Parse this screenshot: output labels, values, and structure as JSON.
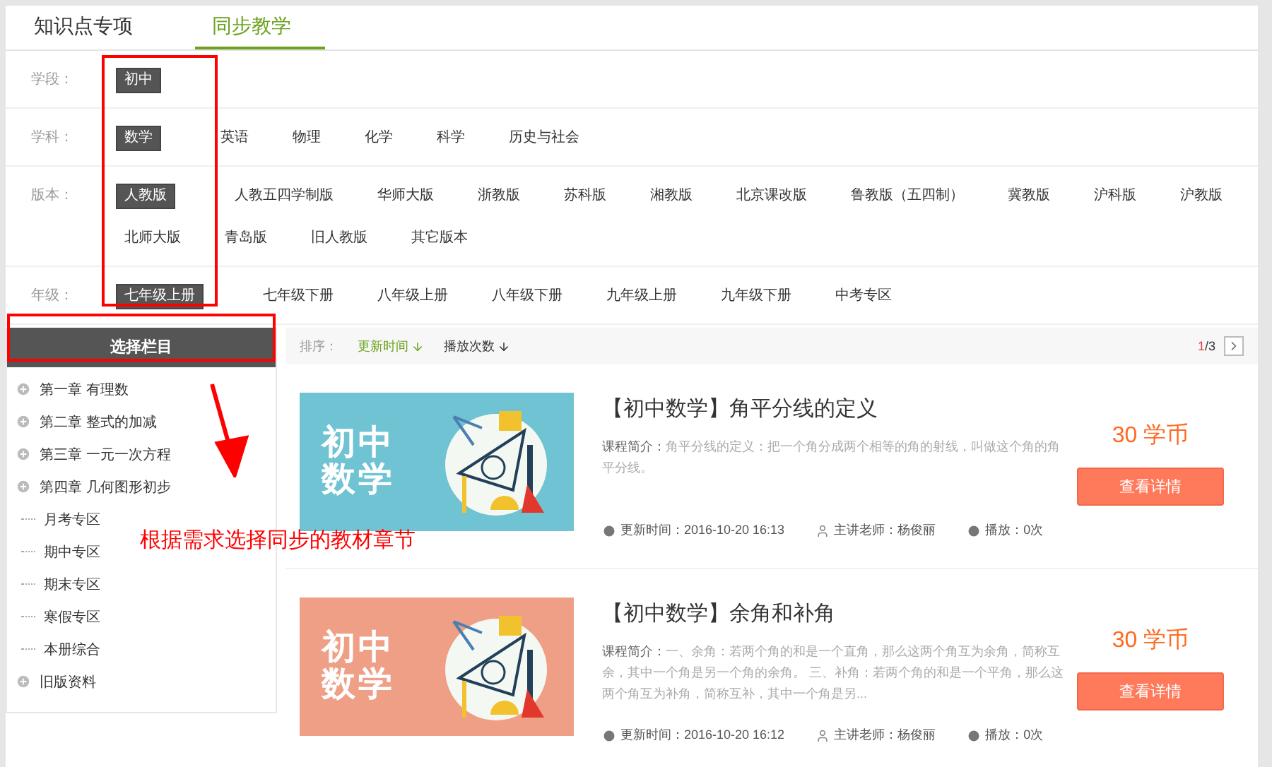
{
  "tabs": [
    {
      "label": "知识点专项",
      "selected": false
    },
    {
      "label": "同步教学",
      "selected": true
    }
  ],
  "filters": [
    {
      "label": "学段：",
      "options": [
        {
          "text": "初中",
          "selected": true
        }
      ]
    },
    {
      "label": "学科：",
      "options": [
        {
          "text": "数学",
          "selected": true
        },
        {
          "text": "英语",
          "selected": false
        },
        {
          "text": "物理",
          "selected": false
        },
        {
          "text": "化学",
          "selected": false
        },
        {
          "text": "科学",
          "selected": false
        },
        {
          "text": "历史与社会",
          "selected": false
        }
      ]
    },
    {
      "label": "版本：",
      "options": [
        {
          "text": "人教版",
          "selected": true
        },
        {
          "text": "人教五四学制版",
          "selected": false
        },
        {
          "text": "华师大版",
          "selected": false
        },
        {
          "text": "浙教版",
          "selected": false
        },
        {
          "text": "苏科版",
          "selected": false
        },
        {
          "text": "湘教版",
          "selected": false
        },
        {
          "text": "北京课改版",
          "selected": false
        },
        {
          "text": "鲁教版（五四制）",
          "selected": false
        },
        {
          "text": "冀教版",
          "selected": false
        },
        {
          "text": "沪科版",
          "selected": false
        },
        {
          "text": "沪教版",
          "selected": false
        },
        {
          "text": "北师大版",
          "selected": false
        },
        {
          "text": "青岛版",
          "selected": false
        },
        {
          "text": "旧人教版",
          "selected": false
        },
        {
          "text": "其它版本",
          "selected": false
        }
      ]
    },
    {
      "label": "年级：",
      "options": [
        {
          "text": "七年级上册",
          "selected": true
        },
        {
          "text": "七年级下册",
          "selected": false
        },
        {
          "text": "八年级上册",
          "selected": false
        },
        {
          "text": "八年级下册",
          "selected": false
        },
        {
          "text": "九年级上册",
          "selected": false
        },
        {
          "text": "九年级下册",
          "selected": false
        },
        {
          "text": "中考专区",
          "selected": false
        }
      ]
    }
  ],
  "sidebar": {
    "title": "选择栏目",
    "items": [
      {
        "kind": "chapter",
        "label": "第一章 有理数"
      },
      {
        "kind": "chapter",
        "label": "第二章 整式的加减"
      },
      {
        "kind": "chapter",
        "label": "第三章 一元一次方程"
      },
      {
        "kind": "chapter",
        "label": "第四章 几何图形初步"
      },
      {
        "kind": "section",
        "label": "月考专区"
      },
      {
        "kind": "section",
        "label": "期中专区"
      },
      {
        "kind": "section",
        "label": "期末专区"
      },
      {
        "kind": "section",
        "label": "寒假专区"
      },
      {
        "kind": "section",
        "label": "本册综合"
      },
      {
        "kind": "chapter",
        "label": "旧版资料"
      }
    ]
  },
  "sort_bar": {
    "label": "排序：",
    "options": [
      {
        "text": "更新时间",
        "selected": true
      },
      {
        "text": "播放次数",
        "selected": false
      }
    ],
    "page_current": "1",
    "page_total": "/3"
  },
  "courses": [
    {
      "banner": {
        "lines": [
          "初中",
          "数学"
        ],
        "color": "#6fc3d3"
      },
      "title": "【初中数学】角平分线的定义",
      "intro_label": "课程简介：",
      "intro": "角平分线的定义：把一个角分成两个相等的角的射线，叫做这个角的角平分线。",
      "updated": "更新时间：2016-10-20 16:13",
      "teacher": "主讲老师：杨俊丽",
      "plays": "播放：0次",
      "price": "30 学币",
      "button": "查看详情"
    },
    {
      "banner": {
        "lines": [
          "初中",
          "数学"
        ],
        "color": "#ee9f86"
      },
      "title": "【初中数学】余角和补角",
      "intro_label": "课程简介：",
      "intro": "一、余角：若两个角的和是一个直角，那么这两个角互为余角，简称互余，其中一个角是另一个角的余角。 三、补角：若两个角的和是一个平角，那么这两个角互为补角，简称互补，其中一个角是另...",
      "updated": "更新时间：2016-10-20 16:12",
      "teacher": "主讲老师：杨俊丽",
      "plays": "播放：0次",
      "price": "30 学币",
      "button": "查看详情"
    }
  ],
  "annotation": {
    "text": "根据需求选择同步的教材章节"
  }
}
